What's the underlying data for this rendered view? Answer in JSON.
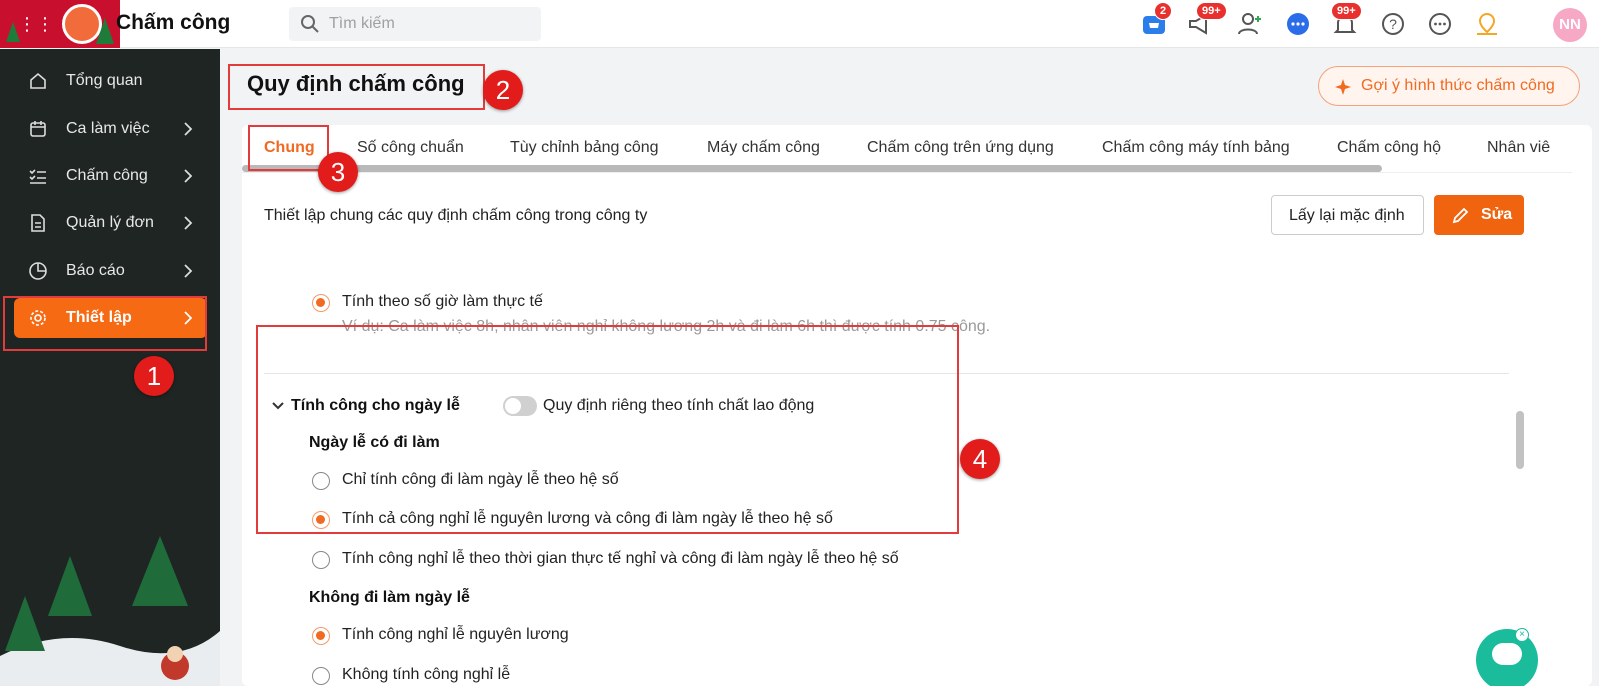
{
  "app": {
    "title": "Chấm công"
  },
  "search": {
    "placeholder": "Tìm kiếm"
  },
  "topbar": {
    "cart_badge": "2",
    "promo_badge": "99+",
    "bell_badge": "99+",
    "avatar_initials": "NN"
  },
  "sidebar": {
    "items": [
      {
        "label": "Tổng quan",
        "icon": "home-icon",
        "has_chevron": false
      },
      {
        "label": "Ca làm việc",
        "icon": "calendar-icon",
        "has_chevron": true
      },
      {
        "label": "Chấm công",
        "icon": "checklist-icon",
        "has_chevron": true
      },
      {
        "label": "Quản lý đơn",
        "icon": "document-icon",
        "has_chevron": true
      },
      {
        "label": "Báo cáo",
        "icon": "pie-chart-icon",
        "has_chevron": true
      },
      {
        "label": "Thiết lập",
        "icon": "gear-icon",
        "has_chevron": true,
        "active": true
      }
    ]
  },
  "main": {
    "page_title": "Quy định chấm công",
    "suggest_button": "Gợi ý hình thức chấm công",
    "tabs": [
      {
        "label": "Chung",
        "active": true
      },
      {
        "label": "Số công chuẩn"
      },
      {
        "label": "Tùy chỉnh bảng công"
      },
      {
        "label": "Máy chấm công"
      },
      {
        "label": "Chấm công trên ứng dụng"
      },
      {
        "label": "Chấm công máy tính bảng"
      },
      {
        "label": "Chấm công hộ"
      },
      {
        "label": "Nhân viê"
      }
    ],
    "description": "Thiết lập chung các quy định chấm công trong công ty",
    "reset_button": "Lấy lại mặc định",
    "edit_button": "Sửa",
    "actual_hours_option": "Tính theo số giờ làm thực tế",
    "actual_hours_example": "Ví dụ: Ca làm việc 8h, nhân viên nghỉ không lương 2h và đi làm 6h thì được tính 0.75 công.",
    "holiday_section": {
      "title": "Tính công cho ngày lễ",
      "toggle_label": "Quy định riêng theo tính chất lao động",
      "toggle_on": false,
      "working_heading": "Ngày lễ có đi làm",
      "working_options": [
        {
          "label": "Chỉ tính công đi làm ngày lễ theo hệ số",
          "checked": false
        },
        {
          "label": "Tính cả công nghỉ lễ nguyên lương và công đi làm ngày lễ theo hệ số",
          "checked": true
        },
        {
          "label": "Tính công nghỉ lễ theo thời gian thực tế nghỉ và công đi làm ngày lễ theo hệ số",
          "checked": false
        }
      ],
      "not_working_heading": "Không đi làm ngày lễ",
      "not_working_options": [
        {
          "label": "Tính công nghỉ lễ nguyên lương",
          "checked": true
        },
        {
          "label": "Không tính công nghỉ lễ",
          "checked": false
        }
      ]
    }
  },
  "annotations": [
    "1",
    "2",
    "3",
    "4"
  ],
  "colors": {
    "accent": "#f06a22",
    "sidebar_bg": "#1e2523",
    "annotation_red": "#e21b1b"
  }
}
